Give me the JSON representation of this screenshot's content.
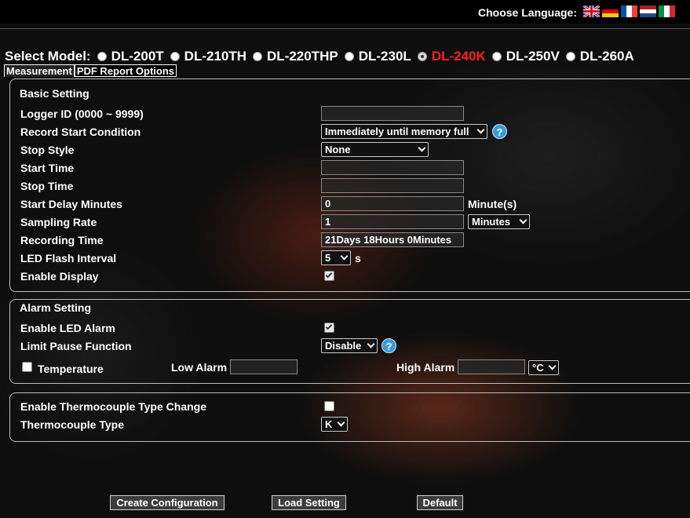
{
  "header": {
    "choose_language": "Choose Language:",
    "flags": [
      "flag-uk-icon",
      "flag-germany-icon",
      "flag-france-icon",
      "flag-netherlands-icon",
      "flag-italy-icon"
    ]
  },
  "model": {
    "label": "Select Model:",
    "options": [
      "DL-200T",
      "DL-210TH",
      "DL-220THP",
      "DL-230L",
      "DL-240K",
      "DL-250V",
      "DL-260A"
    ],
    "selected": "DL-240K",
    "selected_color": "#ff2020"
  },
  "tabs": [
    "Measurement",
    "PDF Report Options"
  ],
  "basic": {
    "title": "Basic Setting",
    "logger_id_label": "Logger ID (0000 ~ 9999)",
    "logger_id_value": "",
    "record_start_label": "Record Start Condition",
    "record_start_value": "Immediately until memory full",
    "stop_style_label": "Stop Style",
    "stop_style_value": "None",
    "start_time_label": "Start Time",
    "start_time_value": "",
    "stop_time_label": "Stop Time",
    "stop_time_value": "",
    "start_delay_label": "Start Delay Minutes",
    "start_delay_value": "0",
    "start_delay_unit": "Minute(s)",
    "sampling_rate_label": "Sampling Rate",
    "sampling_rate_value": "1",
    "sampling_rate_unit": "Minutes",
    "recording_time_label": "Recording Time",
    "recording_time_value": "21Days 18Hours 0Minutes",
    "led_flash_label": "LED Flash Interval",
    "led_flash_value": "5",
    "led_flash_unit": "s",
    "enable_display_label": "Enable Display",
    "enable_display_checked": true
  },
  "alarm": {
    "title": "Alarm Setting",
    "enable_led_label": "Enable LED Alarm",
    "enable_led_checked": true,
    "limit_pause_label": "Limit Pause Function",
    "limit_pause_value": "Disable",
    "temperature_label": "Temperature",
    "temperature_checked": false,
    "low_alarm_label": "Low Alarm",
    "low_alarm_value": "",
    "high_alarm_label": "High Alarm",
    "high_alarm_value": "",
    "unit_value": "°C"
  },
  "thermo": {
    "enable_change_label": "Enable Thermocouple Type Change",
    "enable_change_checked": false,
    "type_label": "Thermocouple Type",
    "type_value": "K"
  },
  "buttons": {
    "create": "Create Configuration",
    "load": "Load Setting",
    "default": "Default"
  }
}
